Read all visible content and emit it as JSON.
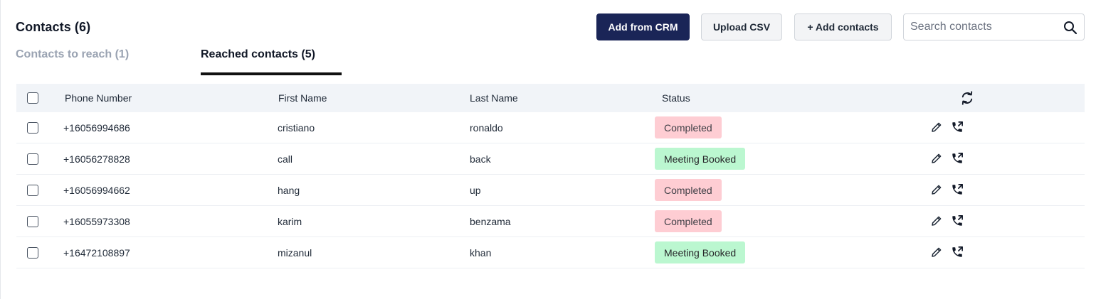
{
  "header": {
    "title": "Contacts (6)",
    "buttons": {
      "add_from_crm": "Add from CRM",
      "upload_csv": "Upload CSV",
      "add_contacts": "+ Add contacts"
    },
    "search": {
      "placeholder": "Search contacts",
      "value": ""
    }
  },
  "tabs": [
    {
      "label": "Contacts to reach (1)",
      "active": false
    },
    {
      "label": "Reached contacts (5)",
      "active": true
    }
  ],
  "table": {
    "columns": [
      "Phone Number",
      "First Name",
      "Last Name",
      "Status"
    ],
    "rows": [
      {
        "phone": "+16056994686",
        "first": "cristiano",
        "last": "ronaldo",
        "status": "Completed",
        "status_type": "completed"
      },
      {
        "phone": "+16056278828",
        "first": "call",
        "last": "back",
        "status": "Meeting Booked",
        "status_type": "booked"
      },
      {
        "phone": "+16056994662",
        "first": "hang",
        "last": "up",
        "status": "Completed",
        "status_type": "completed"
      },
      {
        "phone": "+16055973308",
        "first": "karim",
        "last": "benzama",
        "status": "Completed",
        "status_type": "completed"
      },
      {
        "phone": "+16472108897",
        "first": "mizanul",
        "last": "khan",
        "status": "Meeting Booked",
        "status_type": "booked"
      }
    ]
  },
  "icons": {
    "search": "search-icon",
    "refresh": "refresh-icon",
    "edit": "pencil-icon",
    "call": "phone-call-icon"
  },
  "colors": {
    "primary_button": "#1a2557",
    "completed_badge": "#fecdd3",
    "booked_badge": "#bbf7d0",
    "header_row": "#f1f4f8",
    "inactive_tab": "#9aa3b2"
  }
}
